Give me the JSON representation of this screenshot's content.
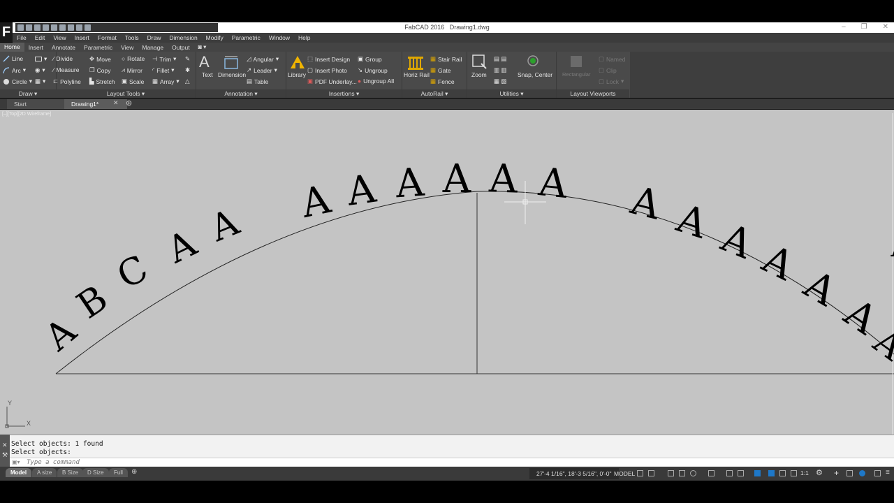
{
  "app": {
    "title": "FabCAD 2016",
    "document": "Drawing1.dwg",
    "logo": "F"
  },
  "menubar": [
    "File",
    "Edit",
    "View",
    "Insert",
    "Format",
    "Tools",
    "Draw",
    "Dimension",
    "Modify",
    "Parametric",
    "Window",
    "Help"
  ],
  "ribbon_tabs": [
    "Home",
    "Insert",
    "Annotate",
    "Parametric",
    "View",
    "Manage",
    "Output"
  ],
  "panels": {
    "draw": {
      "title": "Draw ▾",
      "items": [
        "Line",
        "Arc",
        "Circle"
      ]
    },
    "layout_tools": {
      "title": "Layout Tools ▾",
      "items": [
        "Divide",
        "Measure",
        "Polyline",
        "Move",
        "Copy",
        "Stretch",
        "Rotate",
        "Mirror",
        "Scale",
        "Trim",
        "Fillet",
        "Array"
      ]
    },
    "annotation": {
      "title": "Annotation ▾",
      "text": "Text",
      "dimension": "Dimension",
      "items": [
        "Angular",
        "Leader",
        "Table"
      ]
    },
    "insertions": {
      "title": "Insertions ▾",
      "library": "Library",
      "items": [
        "Insert Design",
        "Insert Photo",
        "PDF Underlay...",
        "Group",
        "Ungroup",
        "Ungroup All"
      ]
    },
    "autorail": {
      "title": "AutoRail ▾",
      "horiz": "Horiz Rail",
      "items": [
        "Stair Rail",
        "Gate",
        "Fence"
      ]
    },
    "utilities": {
      "title": "Utilities ▾",
      "zoom": "Zoom",
      "snap": "Snap, Center"
    },
    "layout_viewports": {
      "title": "Layout Viewports",
      "rect": "Rectangular",
      "items": [
        "Named",
        "Clip",
        "Lock"
      ]
    }
  },
  "doc_tabs": [
    "Start",
    "Drawing1*"
  ],
  "viewport_label": "[–][Top][2D Wireframe]",
  "drawing": {
    "letters_left": [
      "A",
      "B",
      "C",
      "A",
      "A"
    ],
    "letters_arc": [
      "A",
      "A",
      "A",
      "A",
      "A",
      "A"
    ],
    "letters_right": [
      "A",
      "A",
      "A",
      "A",
      "A",
      "A",
      "A",
      "A"
    ]
  },
  "ucs": {
    "x": "X",
    "y": "Y"
  },
  "command": {
    "history": [
      "Select objects: 1 found",
      "Select objects:"
    ],
    "placeholder": "Type a command"
  },
  "layout_tabs": [
    "Model",
    "A size",
    "B Size",
    "D Size",
    "Full"
  ],
  "status": {
    "coords": "27'-4 1/16\", 18'-3 5/16\", 0'-0\"",
    "space": "MODEL",
    "scale": "1:1"
  },
  "colors": {
    "canvas": "#c4c4c4",
    "ribbon": "#4a4a4a",
    "accent": "#1e78c8"
  }
}
